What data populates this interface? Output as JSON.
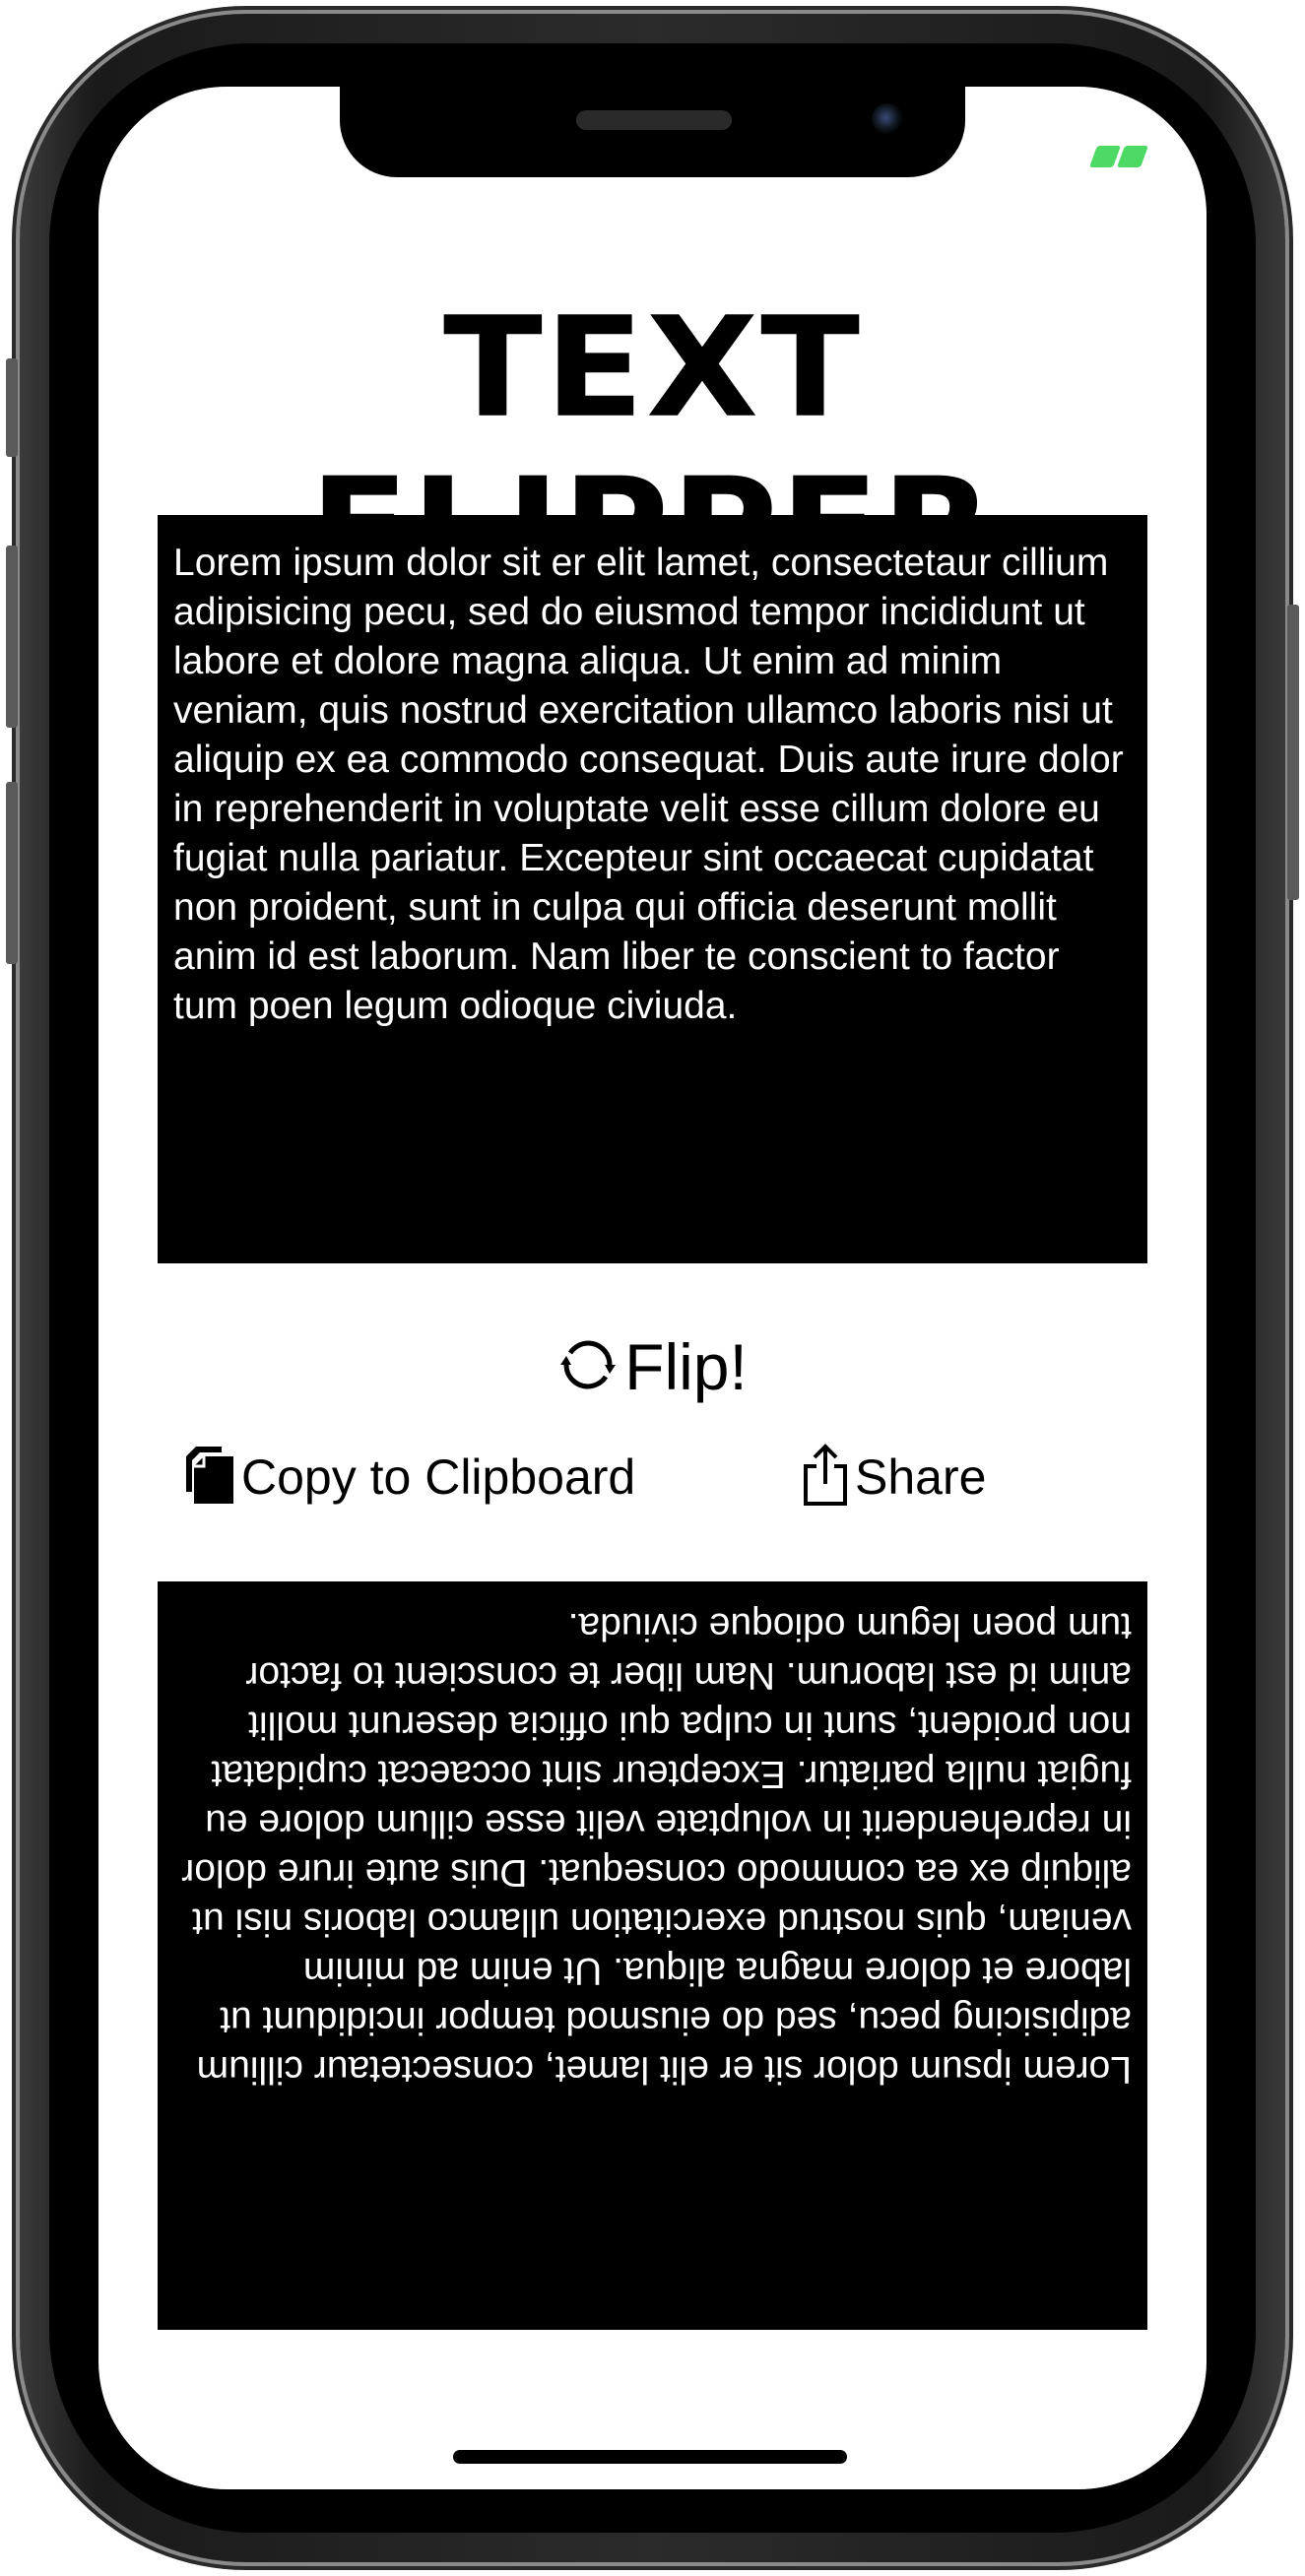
{
  "app": {
    "title": "TEXT FLIPPER"
  },
  "status_bar": {
    "battery_icon": "charging-battery-icon",
    "battery_color": "#4cd964"
  },
  "input": {
    "text": "Lorem ipsum dolor sit er elit lamet, consectetaur cillium adipisicing pecu, sed do eiusmod tempor incididunt ut labore et dolore magna aliqua. Ut enim ad minim veniam, quis nostrud exercitation ullamco laboris nisi ut aliquip ex ea commodo consequat. Duis aute irure dolor in reprehenderit in voluptate velit esse cillum dolore eu fugiat nulla pariatur. Excepteur sint occaecat cupidatat non proident, sunt in culpa qui officia deserunt mollit anim id est laborum. Nam liber te conscient to factor tum poen legum odioque civiuda."
  },
  "actions": {
    "flip_label": "Flip!",
    "flip_icon": "refresh-icon",
    "copy_label": "Copy to Clipboard",
    "copy_icon": "clipboard-icon",
    "share_label": "Share",
    "share_icon": "share-icon"
  },
  "output": {
    "text": "Lorem ipsum dolor sit er elit lamet, consectetaur cillium adipisicing pecu, sed do eiusmod tempor incididunt ut labore et dolore magna aliqua. Ut enim ad minim veniam, quis nostrud exercitation ullamco laboris nisi ut aliquip ex ea commodo consequat. Duis aute irure dolor in reprehenderit in voluptate velit esse cillum dolore eu fugiat nulla pariatur. Excepteur sint occaecat cupidatat non proident, sunt in culpa qui officia deserunt mollit anim id est laborum. Nam liber te conscient to factor tum poen legum odioque civiuda."
  }
}
